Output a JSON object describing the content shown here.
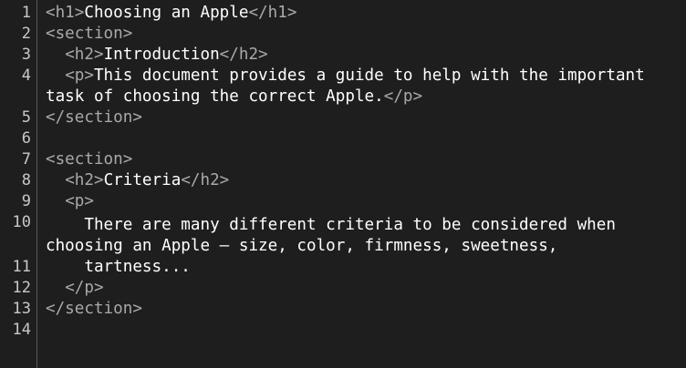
{
  "editor": {
    "line_numbers": [
      "1",
      "2",
      "3",
      "4",
      "5",
      "6",
      "7",
      "8",
      "9",
      "10",
      "11",
      "12",
      "13",
      "14"
    ],
    "lines": {
      "l1": {
        "open": "<h1>",
        "text": "Choosing an Apple",
        "close": "</h1>"
      },
      "l2": {
        "open": "<section>"
      },
      "l3": {
        "indent": "  ",
        "open": "<h2>",
        "text": "Introduction",
        "close": "</h2>"
      },
      "l4": {
        "indent": "  ",
        "open": "<p>",
        "text": "This document provides a guide to help with the important"
      },
      "l4b": {
        "text": "task of choosing the correct Apple.",
        "close": "</p>"
      },
      "l5": {
        "close": "</section>"
      },
      "l7": {
        "open": "<section>"
      },
      "l8": {
        "indent": "  ",
        "open": "<h2>",
        "text": "Criteria",
        "close": "</h2>"
      },
      "l9": {
        "indent": "  ",
        "open": "<p>"
      },
      "l10": {
        "text": "    There are many different criteria to be considered when"
      },
      "l10b": {
        "text": "choosing an Apple — size, color, firmness, sweetness,"
      },
      "l11": {
        "text": "    tartness..."
      },
      "l12": {
        "indent": "  ",
        "close": "</p>"
      },
      "l13": {
        "close": "</section>"
      }
    }
  }
}
